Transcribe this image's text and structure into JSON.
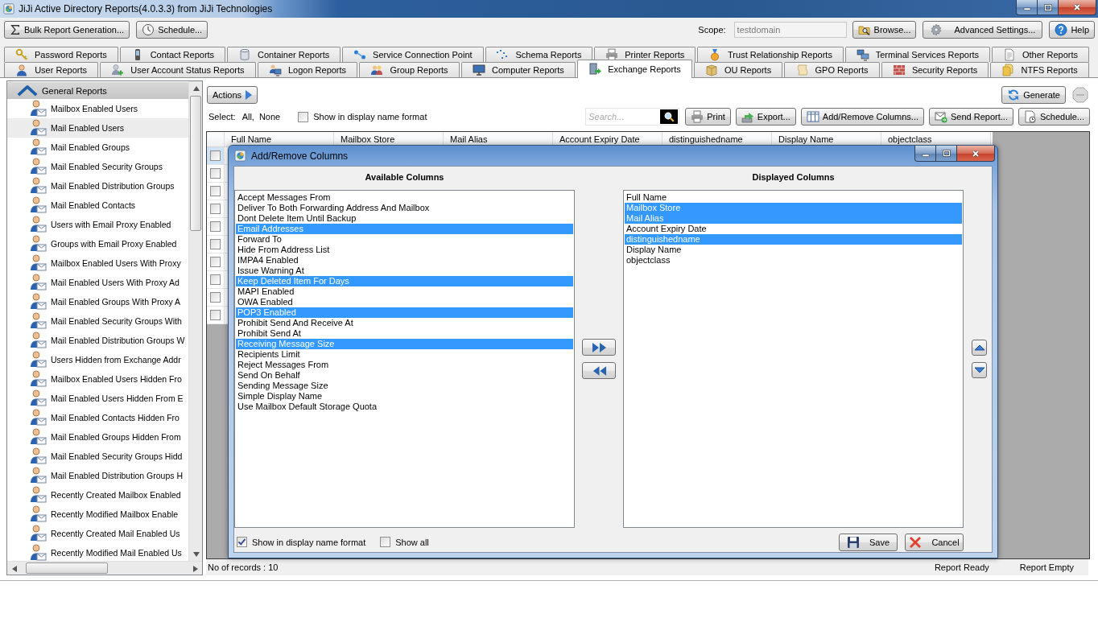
{
  "window": {
    "title": "JiJi Active Directory Reports(4.0.3.3) from JiJi Technologies"
  },
  "toolbar": {
    "bulk_button": "Bulk Report Generation...",
    "schedule_button": "Schedule...",
    "scope": {
      "label": "Scope:",
      "value": "testdomain",
      "disabled": true
    },
    "browse_button": "Browse...",
    "settings_button": "Advanced Settings...",
    "help_button": "Help"
  },
  "tab_rows": [
    {
      "tabs": [
        {
          "label": "Password Reports",
          "selected": false
        },
        {
          "label": "Contact Reports",
          "selected": false
        },
        {
          "label": "Container Reports",
          "selected": false
        },
        {
          "label": "Service Connection Point",
          "selected": false
        },
        {
          "label": "Schema Reports",
          "selected": false
        },
        {
          "label": "Printer Reports",
          "selected": false
        },
        {
          "label": "Trust Relationship Reports",
          "selected": false
        },
        {
          "label": "Terminal Services Reports",
          "selected": false
        },
        {
          "label": "Other Reports",
          "selected": false
        }
      ]
    },
    {
      "tabs": [
        {
          "label": "User Reports",
          "selected": false
        },
        {
          "label": "User Account Status Reports",
          "selected": false
        },
        {
          "label": "Logon Reports",
          "selected": false
        },
        {
          "label": "Group Reports",
          "selected": false
        },
        {
          "label": "Computer Reports",
          "selected": false
        },
        {
          "label": "Exchange Reports",
          "selected": true
        },
        {
          "label": "OU Reports",
          "selected": false
        },
        {
          "label": "GPO Reports",
          "selected": false
        },
        {
          "label": "Security Reports",
          "selected": false
        },
        {
          "label": "NTFS Reports",
          "selected": false
        }
      ]
    }
  ],
  "sidebar": {
    "group": {
      "label": "General Reports",
      "expanded": true
    },
    "items": [
      {
        "label": "Mailbox Enabled Users",
        "selected": false
      },
      {
        "label": "Mail Enabled Users",
        "selected": true
      },
      {
        "label": "Mail Enabled Groups",
        "selected": false
      },
      {
        "label": "Mail Enabled Security Groups",
        "selected": false
      },
      {
        "label": "Mail Enabled Distribution Groups",
        "selected": false
      },
      {
        "label": "Mail Enabled Contacts",
        "selected": false
      },
      {
        "label": "Users with Email Proxy Enabled",
        "selected": false
      },
      {
        "label": "Groups with Email Proxy Enabled",
        "selected": false
      },
      {
        "label": "Mailbox Enabled Users With Proxy",
        "selected": false
      },
      {
        "label": "Mail Enabled Users With Proxy Ad",
        "selected": false
      },
      {
        "label": "Mail Enabled Groups With Proxy A",
        "selected": false
      },
      {
        "label": "Mail Enabled Security Groups With",
        "selected": false
      },
      {
        "label": "Mail Enabled Distribution Groups W",
        "selected": false
      },
      {
        "label": "Users Hidden from Exchange Addr",
        "selected": false
      },
      {
        "label": "Mailbox Enabled Users Hidden Fro",
        "selected": false
      },
      {
        "label": "Mail Enabled Users Hidden From E",
        "selected": false
      },
      {
        "label": "Mail Enabled Contacts Hidden Fro",
        "selected": false
      },
      {
        "label": "Mail Enabled Groups Hidden From",
        "selected": false
      },
      {
        "label": "Mail Enabled Security Groups Hidd",
        "selected": false
      },
      {
        "label": "Mail Enabled Distribution Groups H",
        "selected": false
      },
      {
        "label": "Recently Created Mailbox Enabled",
        "selected": false
      },
      {
        "label": "Recently Modified Mailbox Enable",
        "selected": false
      },
      {
        "label": "Recently Created Mail Enabled Us",
        "selected": false
      },
      {
        "label": "Recently Modified Mail Enabled Us",
        "selected": false
      }
    ]
  },
  "report": {
    "actions_button": "Actions",
    "generate_button": "Generate",
    "select": {
      "label": "Select:",
      "options": [
        "All,",
        "None"
      ]
    },
    "display_name_option": {
      "label": "Show in display name format",
      "checked": false
    },
    "search": {
      "placeholder": "Search..."
    },
    "buttons": [
      "Print",
      "Export...",
      "Add/Remove Columns...",
      "Send Report...",
      "Schedule..."
    ],
    "table": {
      "columns": [
        "Full Name",
        "Mailbox Store",
        "Mail Alias",
        "Account Expiry Date",
        "distinguishedname",
        "Display Name",
        "objectclass"
      ],
      "rows": [
        {
          "checked": false,
          "selected": true
        },
        {
          "checked": false,
          "selected": false
        },
        {
          "checked": false,
          "selected": false
        },
        {
          "checked": false,
          "selected": false
        },
        {
          "checked": false,
          "selected": false
        },
        {
          "checked": false,
          "selected": false
        },
        {
          "checked": false,
          "selected": false
        },
        {
          "checked": false,
          "selected": false
        },
        {
          "checked": false,
          "selected": false
        },
        {
          "checked": false,
          "selected": false
        }
      ]
    }
  },
  "status_bar": {
    "record_count": "No of records : 10",
    "messages": [
      "Report Ready",
      "Report Empty"
    ]
  },
  "dialog": {
    "title": "Add/Remove Columns",
    "available": {
      "heading": "Available Columns",
      "items": [
        {
          "label": "Accept Messages From",
          "selected": false
        },
        {
          "label": "Deliver To Both Forwarding Address And Mailbox",
          "selected": false
        },
        {
          "label": "Dont Delete Item Until Backup",
          "selected": false
        },
        {
          "label": "Email Addresses",
          "selected": true
        },
        {
          "label": "Forward To",
          "selected": false
        },
        {
          "label": "Hide From Address List",
          "selected": false
        },
        {
          "label": "IMPA4 Enabled",
          "selected": false
        },
        {
          "label": "Issue Warning At",
          "selected": false
        },
        {
          "label": "Keep Deleted Item For Days",
          "selected": true
        },
        {
          "label": "MAPI Enabled",
          "selected": false
        },
        {
          "label": "OWA Enabled",
          "selected": false
        },
        {
          "label": "POP3 Enabled",
          "selected": true
        },
        {
          "label": "Prohibit Send And Receive At",
          "selected": false
        },
        {
          "label": "Prohibit Send At",
          "selected": false
        },
        {
          "label": "Receiving Message Size",
          "selected": true
        },
        {
          "label": "Recipients Limit",
          "selected": false
        },
        {
          "label": "Reject Messages From",
          "selected": false
        },
        {
          "label": "Send On Behalf",
          "selected": false
        },
        {
          "label": "Sending Message Size",
          "selected": false
        },
        {
          "label": "Simple Display Name",
          "selected": false
        },
        {
          "label": "Use Mailbox Default Storage Quota",
          "selected": false
        }
      ]
    },
    "displayed": {
      "heading": "Displayed Columns",
      "items": [
        {
          "label": "Full Name",
          "selected": false
        },
        {
          "label": "Mailbox Store",
          "selected": true
        },
        {
          "label": "Mail Alias",
          "selected": true
        },
        {
          "label": "Account Expiry Date",
          "selected": false
        },
        {
          "label": "distinguishedname",
          "selected": true
        },
        {
          "label": "Display Name",
          "selected": false
        },
        {
          "label": "objectclass",
          "selected": false
        }
      ]
    },
    "options": [
      {
        "label": "Show in display name format",
        "checked": true
      },
      {
        "label": "Show all",
        "checked": false
      }
    ],
    "save_button": "Save",
    "cancel_button": "Cancel"
  }
}
